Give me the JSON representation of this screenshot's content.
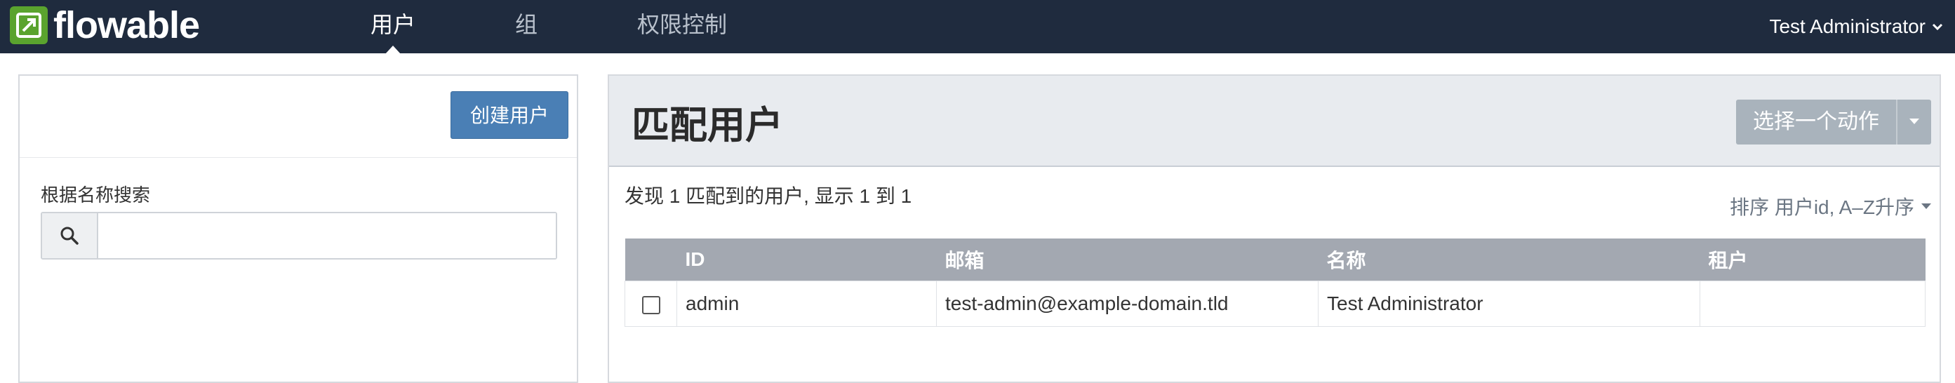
{
  "app": {
    "name": "flowable",
    "logo_text": "flowable"
  },
  "nav": {
    "items": [
      {
        "label": "用户",
        "active": true
      },
      {
        "label": "组",
        "active": false
      },
      {
        "label": "权限控制",
        "active": false
      }
    ],
    "user": "Test Administrator"
  },
  "left": {
    "create_button": "创建用户",
    "search_label": "根据名称搜索",
    "search_value": ""
  },
  "main": {
    "title": "匹配用户",
    "action_button": "选择一个动作",
    "summary": "发现 1 匹配到的用户, 显示 1 到 1",
    "sort_label": "排序 用户id, A–Z升序",
    "table": {
      "columns": [
        "ID",
        "邮箱",
        "名称",
        "租户"
      ],
      "rows": [
        {
          "id": "admin",
          "email": "test-admin@example-domain.tld",
          "name": "Test Administrator",
          "tenant": ""
        }
      ]
    }
  },
  "colors": {
    "navbar": "#1f2b3e",
    "brand_green": "#5aa32e",
    "primary_button": "#4a7fb5",
    "disabled_button": "#a9b3bc",
    "table_header": "#a3a8b1"
  }
}
